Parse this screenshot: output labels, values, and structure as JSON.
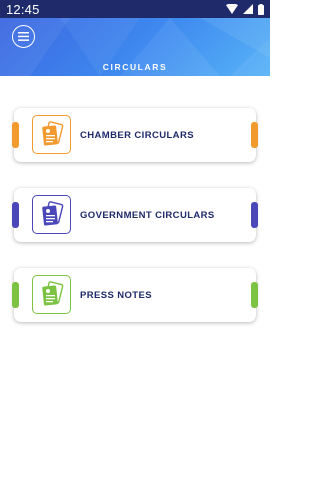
{
  "status_bar": {
    "time": "12:45"
  },
  "header": {
    "title": "CIRCULARS"
  },
  "cards": [
    {
      "label": "CHAMBER CIRCULARS",
      "color": "#f29a2e",
      "icon": "document-stack-icon"
    },
    {
      "label": "GOVERNMENT CIRCULARS",
      "color": "#4a47b8",
      "icon": "document-stack-icon"
    },
    {
      "label": "PRESS NOTES",
      "color": "#7cc243",
      "icon": "document-stack-icon"
    }
  ],
  "colors": {
    "status_bar": "#1f2a6b",
    "header_gradient": [
      "#3b66e0",
      "#58b4f7"
    ],
    "label_text": "#1f2a6b"
  }
}
